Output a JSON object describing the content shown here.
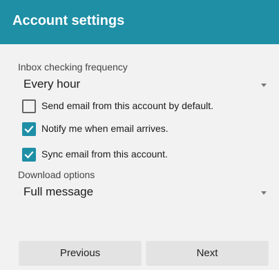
{
  "header": {
    "title": "Account settings"
  },
  "settings": {
    "frequency_label": "Inbox checking frequency",
    "frequency_value": "Every hour",
    "checkboxes": [
      {
        "label": "Send email from this account by default.",
        "checked": false
      },
      {
        "label": "Notify me when email arrives.",
        "checked": true
      },
      {
        "label": "Sync email from this account.",
        "checked": true
      }
    ],
    "download_label": "Download options",
    "download_value": "Full message"
  },
  "footer": {
    "previous_label": "Previous",
    "next_label": "Next"
  },
  "colors": {
    "accent": "#1f8fa6"
  },
  "icons": {
    "dropdown": "dropdown-arrow-icon",
    "check": "checkmark-icon"
  }
}
